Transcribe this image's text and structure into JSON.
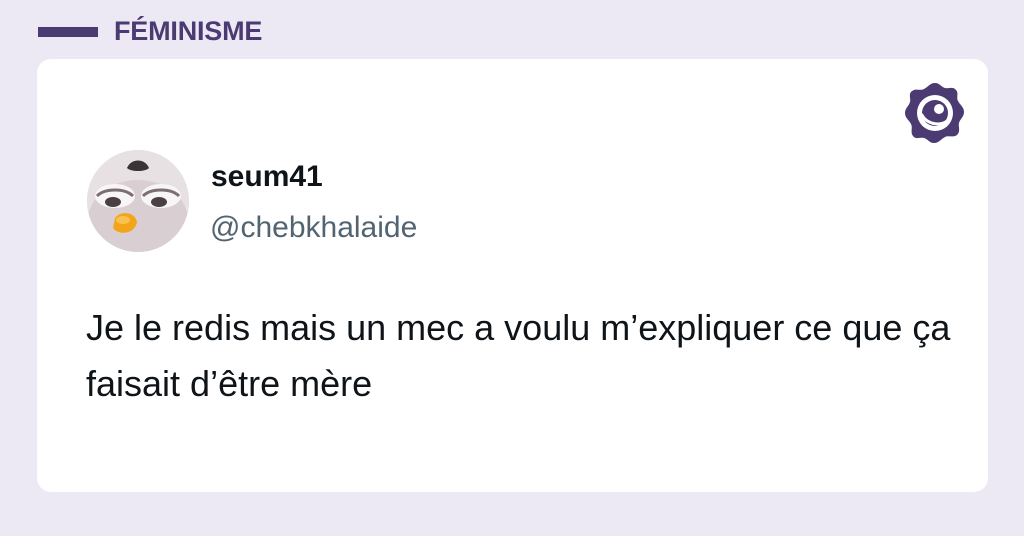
{
  "category": {
    "label": "FÉMINISME"
  },
  "brand": {
    "icon": "brand-logo-icon",
    "color": "#4b3b72"
  },
  "tweet": {
    "display_name": "seum41",
    "handle": "@chebkhalaide",
    "avatar_icon": "furby-avatar",
    "text": "Je le redis mais un mec a voulu m’expliquer ce que ça faisait d’être mère"
  },
  "colors": {
    "page_background": "#ede9f4",
    "card_background": "#ffffff",
    "accent": "#4b3b72",
    "text_primary": "#0f1419",
    "text_secondary": "#536471"
  }
}
